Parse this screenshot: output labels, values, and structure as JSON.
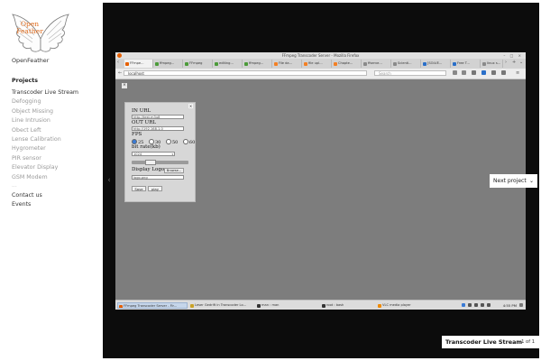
{
  "site": {
    "logo_text": "Open Feather",
    "name": "OpenFeather"
  },
  "nav": {
    "heading": "Projects",
    "items": [
      {
        "label": "Transcoder Live Stream",
        "active": true
      },
      {
        "label": "Defogging"
      },
      {
        "label": "Object Missing"
      },
      {
        "label": "Line Intrusion"
      },
      {
        "label": "Obect Left"
      },
      {
        "label": "Lense Calibration"
      },
      {
        "label": "Hygrometer"
      },
      {
        "label": "PIR sensor"
      },
      {
        "label": "Elevator Display"
      },
      {
        "label": "GSM Modem"
      }
    ],
    "ellipsis": "...",
    "footer": [
      "Contact us",
      "Events"
    ]
  },
  "lightbox": {
    "prev_icon": "chevron-left-icon",
    "next_label": "Next project",
    "next_icon": "chevron-down-icon",
    "caption_title": "Transcoder Live Stream",
    "caption_count": "1 of 1"
  },
  "screenshot": {
    "window_title": "FFmpeg Transcoder Server - Mozilla Firefox",
    "tabs": [
      "FFmpe...",
      "ffmpeg...",
      "FFmpeg",
      "editing...",
      "ffmpeg...",
      "File da...",
      "file upl...",
      "Chapte...",
      "ffserve...",
      "Scienti...",
      "[SOLVE...",
      "Free T...",
      "linux s..."
    ],
    "url": "localhost",
    "search_placeholder": "Search",
    "close_mark": "×",
    "panel": {
      "close": "×",
      "in_url_label": "IN URL",
      "in_url_value": "http://test.m3u8",
      "out_url_label": "OUT URL",
      "out_url_value": "http://192.168.1.0",
      "fps_label": "FPS",
      "fps_options": [
        "25",
        "30",
        "50",
        "60"
      ],
      "fps_selected": "25",
      "bitrate_label": "bit rate(kb)",
      "bitrate_value": "1024",
      "slider_level": 0.3,
      "logo_label": "Display Logo",
      "browse_label": "Browse...",
      "logo_value": "logo.png",
      "save_label": "Save",
      "play_label": "play"
    },
    "taskbar": [
      "FFmpeg Transcoder Server - Fir...",
      "Leser Gedrift in Transcoder Lo...",
      "man : man",
      "root : bash",
      "VLC media player"
    ],
    "clock": "4:55 PM"
  }
}
